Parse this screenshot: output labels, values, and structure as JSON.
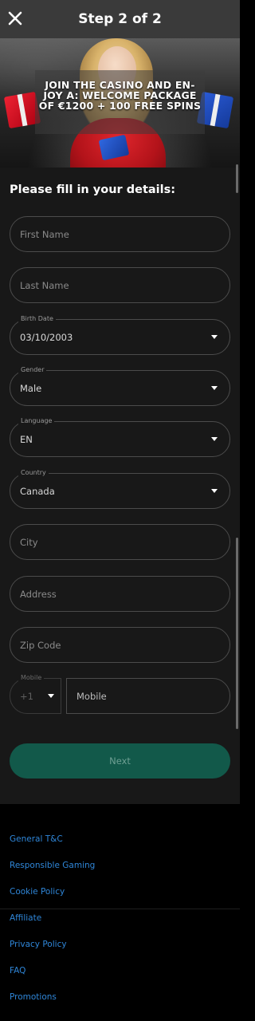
{
  "header": {
    "title": "Step 2 of 2"
  },
  "banner": {
    "text": "JOIN THE CASINO AND EN- JOY A: WELCOME PACKAGE OF €1200 + 100 FREE SPINS"
  },
  "form": {
    "heading": "Please fill in your details:",
    "first_name": {
      "placeholder": "First Name"
    },
    "last_name": {
      "placeholder": "Last Name"
    },
    "birth_date": {
      "label": "Birth Date",
      "value": "03/10/2003"
    },
    "gender": {
      "label": "Gender",
      "value": "Male"
    },
    "language": {
      "label": "Language",
      "value": "EN"
    },
    "country": {
      "label": "Country",
      "value": "Canada"
    },
    "city": {
      "placeholder": "City"
    },
    "address": {
      "placeholder": "Address"
    },
    "zip": {
      "placeholder": "Zip Code"
    },
    "mobile": {
      "label": "Mobile",
      "code": "+1",
      "placeholder": "Mobile"
    },
    "next_label": "Next"
  },
  "footer": {
    "links": [
      "General T&C",
      "Responsible Gaming",
      "Cookie Policy",
      "Affiliate",
      "Privacy Policy",
      "FAQ",
      "Promotions"
    ]
  },
  "colors": {
    "header_bg": "#3a3a3a",
    "panel_bg": "#181818",
    "button_bg": "#12594a",
    "link": "#2f86d8"
  }
}
